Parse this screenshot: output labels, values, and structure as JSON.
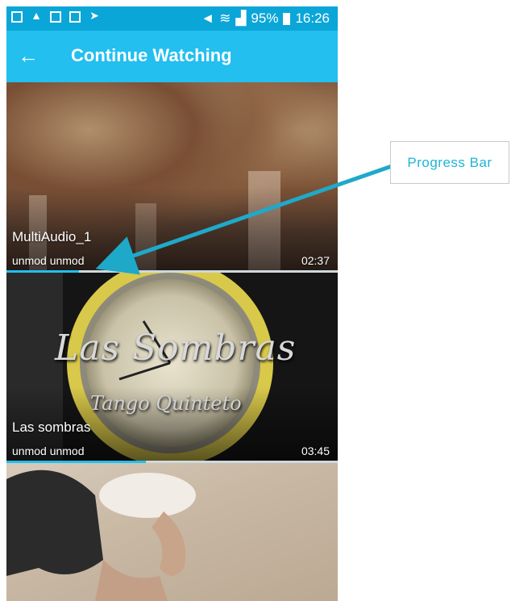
{
  "status_bar": {
    "battery": "95%",
    "time": "16:26"
  },
  "app_bar": {
    "title": "Continue Watching"
  },
  "items": [
    {
      "title": "MultiAudio_1",
      "subtitle": "unmod unmod",
      "duration": "02:37",
      "progress": 0.22
    },
    {
      "title": "Las sombras",
      "subtitle": "unmod unmod",
      "duration": "03:45",
      "progress": 0.42
    },
    {
      "title": "",
      "subtitle": "",
      "duration": "",
      "progress": 0
    }
  ],
  "overlay_thumb_text": {
    "line1": "Las Sombras",
    "line2": "Tango Quinteto"
  },
  "annotation": {
    "label": "Progress Bar",
    "color": "#1fb4d6"
  },
  "colors": {
    "status_bar": "#0aa6d8",
    "app_bar": "#22bfef",
    "progress": "#22bfef"
  }
}
